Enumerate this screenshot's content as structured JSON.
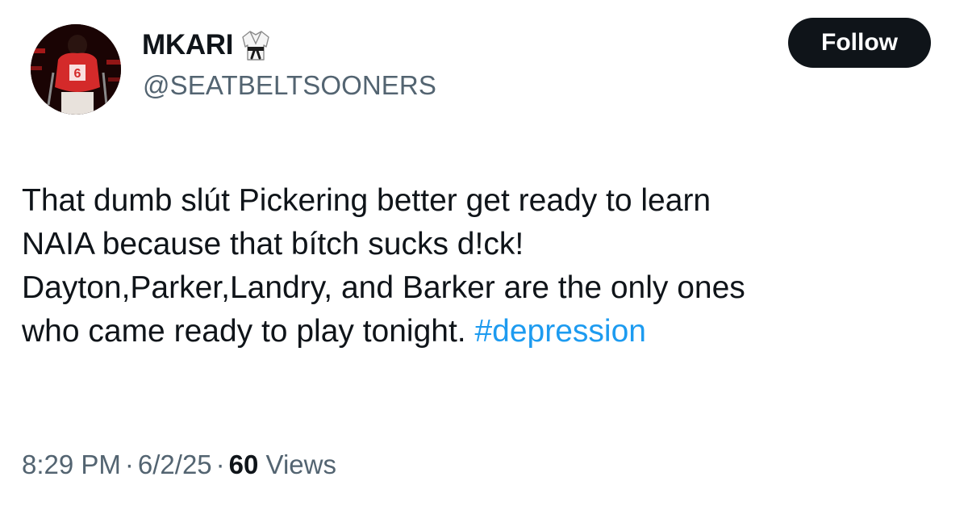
{
  "author": {
    "display_name": "MKARI",
    "name_emoji": "martial-arts-uniform-emoji",
    "handle": "@SEATBELTSOONERS",
    "avatar": "football-player-avatar"
  },
  "follow_button": {
    "label": "Follow"
  },
  "tweet": {
    "lines": [
      "That dumb slút Pickering better get ready to learn",
      "NAIA because that bítch sucks d!ck!",
      "Dayton,Parker,Landry, and Barker are the only ones",
      "who came ready to play tonight. "
    ],
    "hashtag": "#depression"
  },
  "meta": {
    "time": "8:29 PM",
    "date": "6/2/25",
    "separator": "·",
    "views_count": "60",
    "views_label": "Views"
  },
  "colors": {
    "text": "#0f1419",
    "secondary": "#536471",
    "link": "#1d9bf0",
    "button_bg": "#0f1419"
  }
}
